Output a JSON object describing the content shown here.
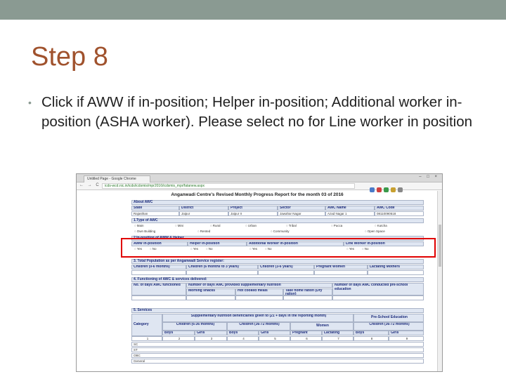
{
  "slide": {
    "title": "Step 8",
    "bullet": "Click if AWW if in-position; Helper in-position; Additional worker in-position (ASHA worker). Please select no for Line worker in position"
  },
  "browser": {
    "tab_title": "Untitled Page - Google Chrome",
    "window_controls": "– □ ×",
    "nav_icons": "← → C",
    "url": "icds-wcd.nic.in/icds/icdsmis/mpr2016/icdsmis_mpr/fatanew.aspx"
  },
  "report": {
    "title": "Anganwadi Centre's Revised Monthly Progress Report for the month 03 of 2016",
    "about": {
      "heading": "About AWC",
      "columns": [
        "State",
        "District",
        "Project",
        "Sector",
        "AWC Name",
        "AWC Code"
      ],
      "values": [
        "Rajasthan",
        "Jaipur",
        "Jaipur II",
        "Jawahar Nagar",
        "Azad Nagar 1",
        "08110090518"
      ]
    },
    "type_awc": {
      "heading": "1.Type of AWC",
      "row1": [
        "Main",
        "Mini",
        "Rural",
        "Urban",
        "Tribal",
        "Pucca",
        "Kutcha"
      ],
      "row2": [
        "Own Building",
        "Rented",
        "Community",
        "Open Space"
      ]
    },
    "position": {
      "heading": "2.In-position of AWW & Helper",
      "fields": [
        "AWW in-position",
        "Helper in-position",
        "Additional Worker in-position",
        "Link Worker in-position"
      ],
      "yes": "Yes",
      "no": "No"
    },
    "population": {
      "heading": "3. Total Population as per Anganwadi Service register:",
      "columns": [
        "Children (0-6 months)",
        "Children  (6 months to 3 years)",
        "Children (3-6 years)",
        "Pregnant Women",
        "Lactating Mothers"
      ]
    },
    "functioning": {
      "heading": "4. Functioning of AWC & services delivered:",
      "days_label": "No. of days AWC functioned",
      "supp_label": "Number of days AWC provided supplementary nutrition",
      "snacks": "Morning snacks",
      "hot": "Hot cooked meals",
      "thr": "Take home ration (Dry ration)",
      "preschool": "Number of days AWC conducted pre-school education"
    },
    "services": {
      "heading": "5. Services",
      "supp_header": "Supplementary nutrition beneficiaries given to (21 + days in the reporting month)",
      "pse_header": "Pre-School Education",
      "category": "Category",
      "groups": [
        "Children (6-36 months)",
        "Children (36-72 months)",
        "Women",
        "Children (36-72 months)"
      ],
      "subcols": [
        "Boys",
        "Girls",
        "Boys",
        "Girls",
        "Pregnant",
        "Lactating",
        "Boys",
        "Girls"
      ],
      "numbers": [
        "1",
        "2",
        "3",
        "4",
        "5",
        "6",
        "7",
        "8",
        "9"
      ],
      "rows": [
        "SC",
        "ST",
        "OBC",
        "General"
      ]
    }
  },
  "colors": {
    "title": "#a0522d",
    "top_bar": "#8a9a92",
    "highlight": "#e00000"
  }
}
